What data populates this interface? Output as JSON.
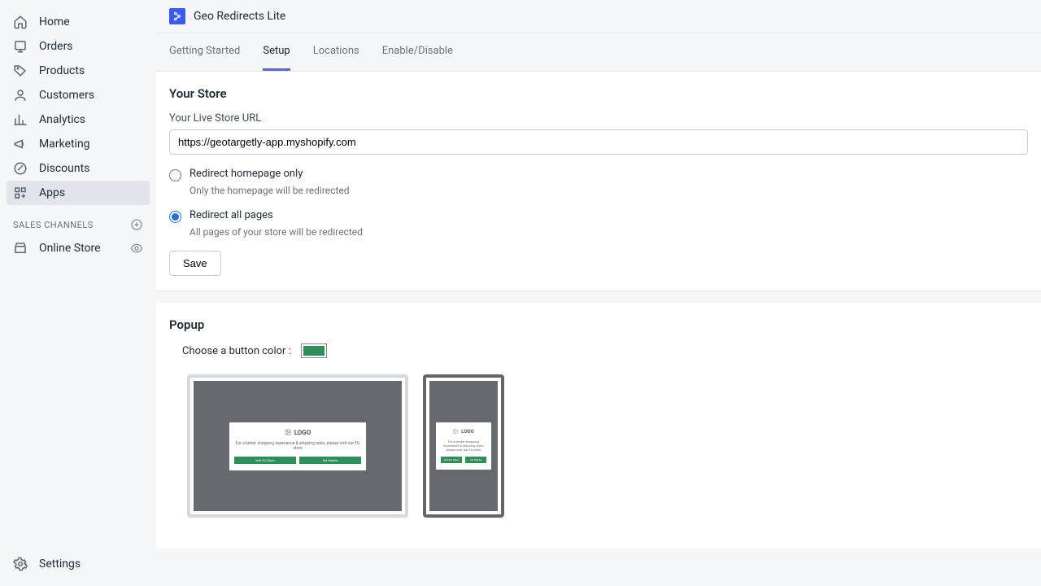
{
  "sidebar": {
    "items": [
      {
        "label": "Home"
      },
      {
        "label": "Orders"
      },
      {
        "label": "Products"
      },
      {
        "label": "Customers"
      },
      {
        "label": "Analytics"
      },
      {
        "label": "Marketing"
      },
      {
        "label": "Discounts"
      },
      {
        "label": "Apps"
      }
    ],
    "section_label": "SALES CHANNELS",
    "channels": [
      {
        "label": "Online Store"
      }
    ],
    "settings_label": "Settings"
  },
  "header": {
    "app_title": "Geo Redirects Lite"
  },
  "tabs": [
    {
      "label": "Getting Started"
    },
    {
      "label": "Setup"
    },
    {
      "label": "Locations"
    },
    {
      "label": "Enable/Disable"
    }
  ],
  "store": {
    "heading": "Your Store",
    "url_label": "Your Live Store URL",
    "url_value": "https://geotargetly-app.myshopify.com",
    "opt1_label": "Redirect homepage only",
    "opt1_desc": "Only the homepage will be redirected",
    "opt2_label": "Redirect all pages",
    "opt2_desc": "All pages of your store will be redirected",
    "save_label": "Save"
  },
  "popup": {
    "heading": "Popup",
    "color_label": "Choose a button color :",
    "color_value": "#328c5b",
    "preview_logo": "LOGO",
    "preview_text": "For a better shopping experience & shipping rates, please visit our EU store",
    "preview_btn1": "Visit EU Store",
    "preview_btn2": "No thanks"
  }
}
